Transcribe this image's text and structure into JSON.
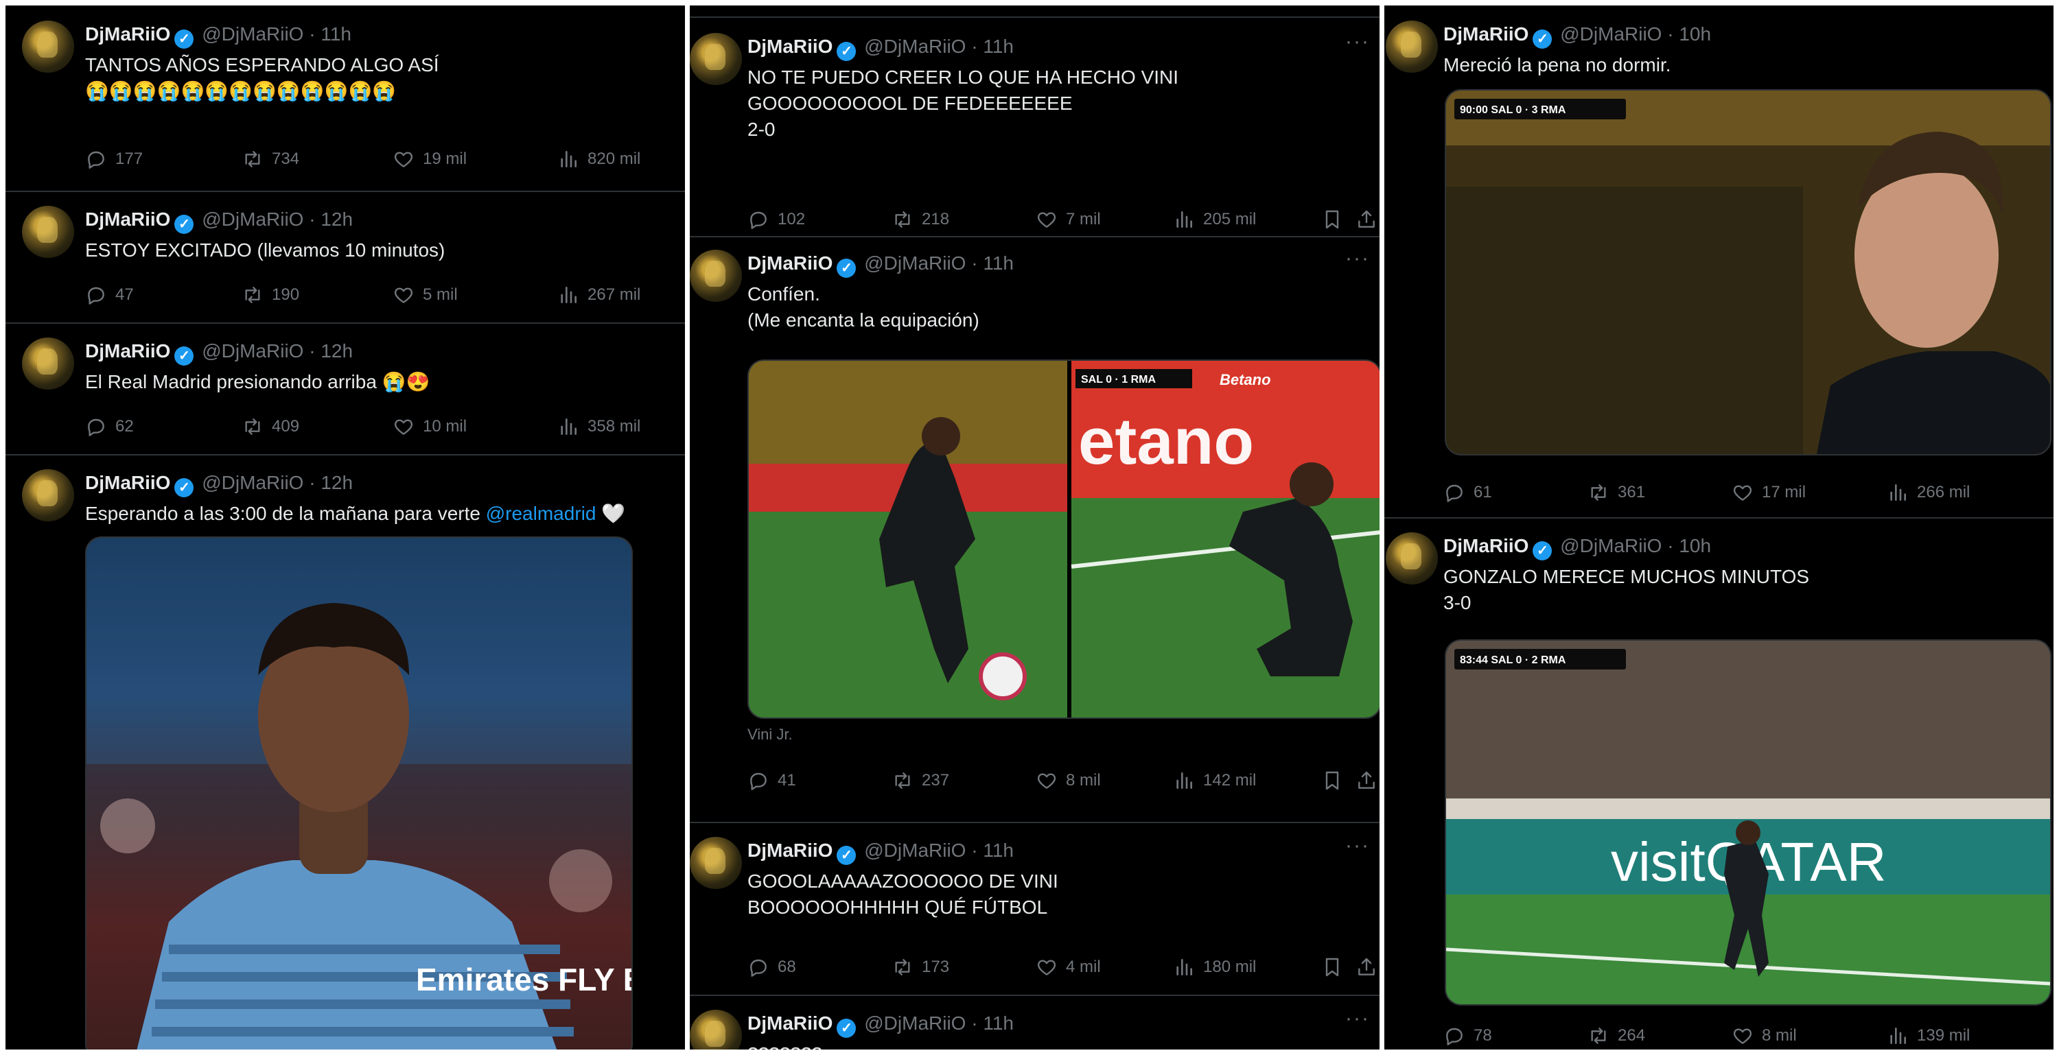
{
  "author": {
    "name": "DjMaRiiO",
    "handle": "@DjMaRiiO",
    "verified_icon": "verified-badge-icon"
  },
  "colors": {
    "background": "#000000",
    "text": "#e7e9ea",
    "muted": "#71767b",
    "accent": "#1d9bf0",
    "divider": "#2f3336"
  },
  "columns": [
    {
      "tweets": [
        {
          "time": "11h",
          "lines": [
            "TANTOS AÑOS ESPERANDO ALGO ASÍ",
            "",
            "😭😭😭😭😭😭😭😭😭😭😭😭😭"
          ],
          "replies": "177",
          "retweets": "734",
          "likes": "19 mil",
          "views": "820 mil"
        },
        {
          "time": "12h",
          "lines": [
            "ESTOY EXCITADO (llevamos 10 minutos)"
          ],
          "replies": "47",
          "retweets": "190",
          "likes": "5 mil",
          "views": "267 mil"
        },
        {
          "time": "12h",
          "lines": [
            "El Real Madrid presionando arriba 😭😍"
          ],
          "replies": "62",
          "retweets": "409",
          "likes": "10 mil",
          "views": "358 mil"
        },
        {
          "time": "12h",
          "text_before": "Esperando a las 3:00 de la mañana para verte ",
          "mention": "@realmadrid",
          "text_after": " 🤍",
          "jersey_text": "Emirates FLY BETTER"
        }
      ]
    },
    {
      "tweets": [
        {
          "time": "11h",
          "lines": [
            "NO TE PUEDO CREER LO QUE HA HECHO VINI",
            "",
            "GOOOOOOOOOL DE FEDEEEEEEE",
            "",
            "2-0"
          ],
          "replies": "102",
          "retweets": "218",
          "likes": "7 mil",
          "views": "205 mil"
        },
        {
          "time": "11h",
          "lines": [
            "Confíen.",
            "",
            "(Me encanta la equipación)"
          ],
          "media_caption": "Vini Jr.",
          "scorebug": "SAL 0 · 1 RMA",
          "sponsor": "Betano",
          "replies": "41",
          "retweets": "237",
          "likes": "8 mil",
          "views": "142 mil"
        },
        {
          "time": "11h",
          "lines": [
            "GOOOLAAAAAZOOOOOO DE VINI",
            "",
            "BOOOOOOHHHHH QUÉ FÚTBOL"
          ],
          "replies": "68",
          "retweets": "173",
          "likes": "4 mil",
          "views": "180 mil"
        },
        {
          "time": "11h",
          "lines": [
            "???????"
          ]
        }
      ]
    },
    {
      "tweets": [
        {
          "time": "10h",
          "lines": [
            "Mereció la pena no dormir."
          ],
          "scorebug": "90:00 SAL 0 · 3 RMA",
          "replies": "61",
          "retweets": "361",
          "likes": "17 mil",
          "views": "266 mil"
        },
        {
          "time": "10h",
          "lines": [
            "GONZALO MERECE MUCHOS MINUTOS",
            "",
            "3-0"
          ],
          "scorebug": "83:44 SAL 0 · 2 RMA",
          "board": "visitQATAR",
          "replies": "78",
          "retweets": "264",
          "likes": "8 mil",
          "views": "139 mil"
        }
      ]
    }
  ]
}
